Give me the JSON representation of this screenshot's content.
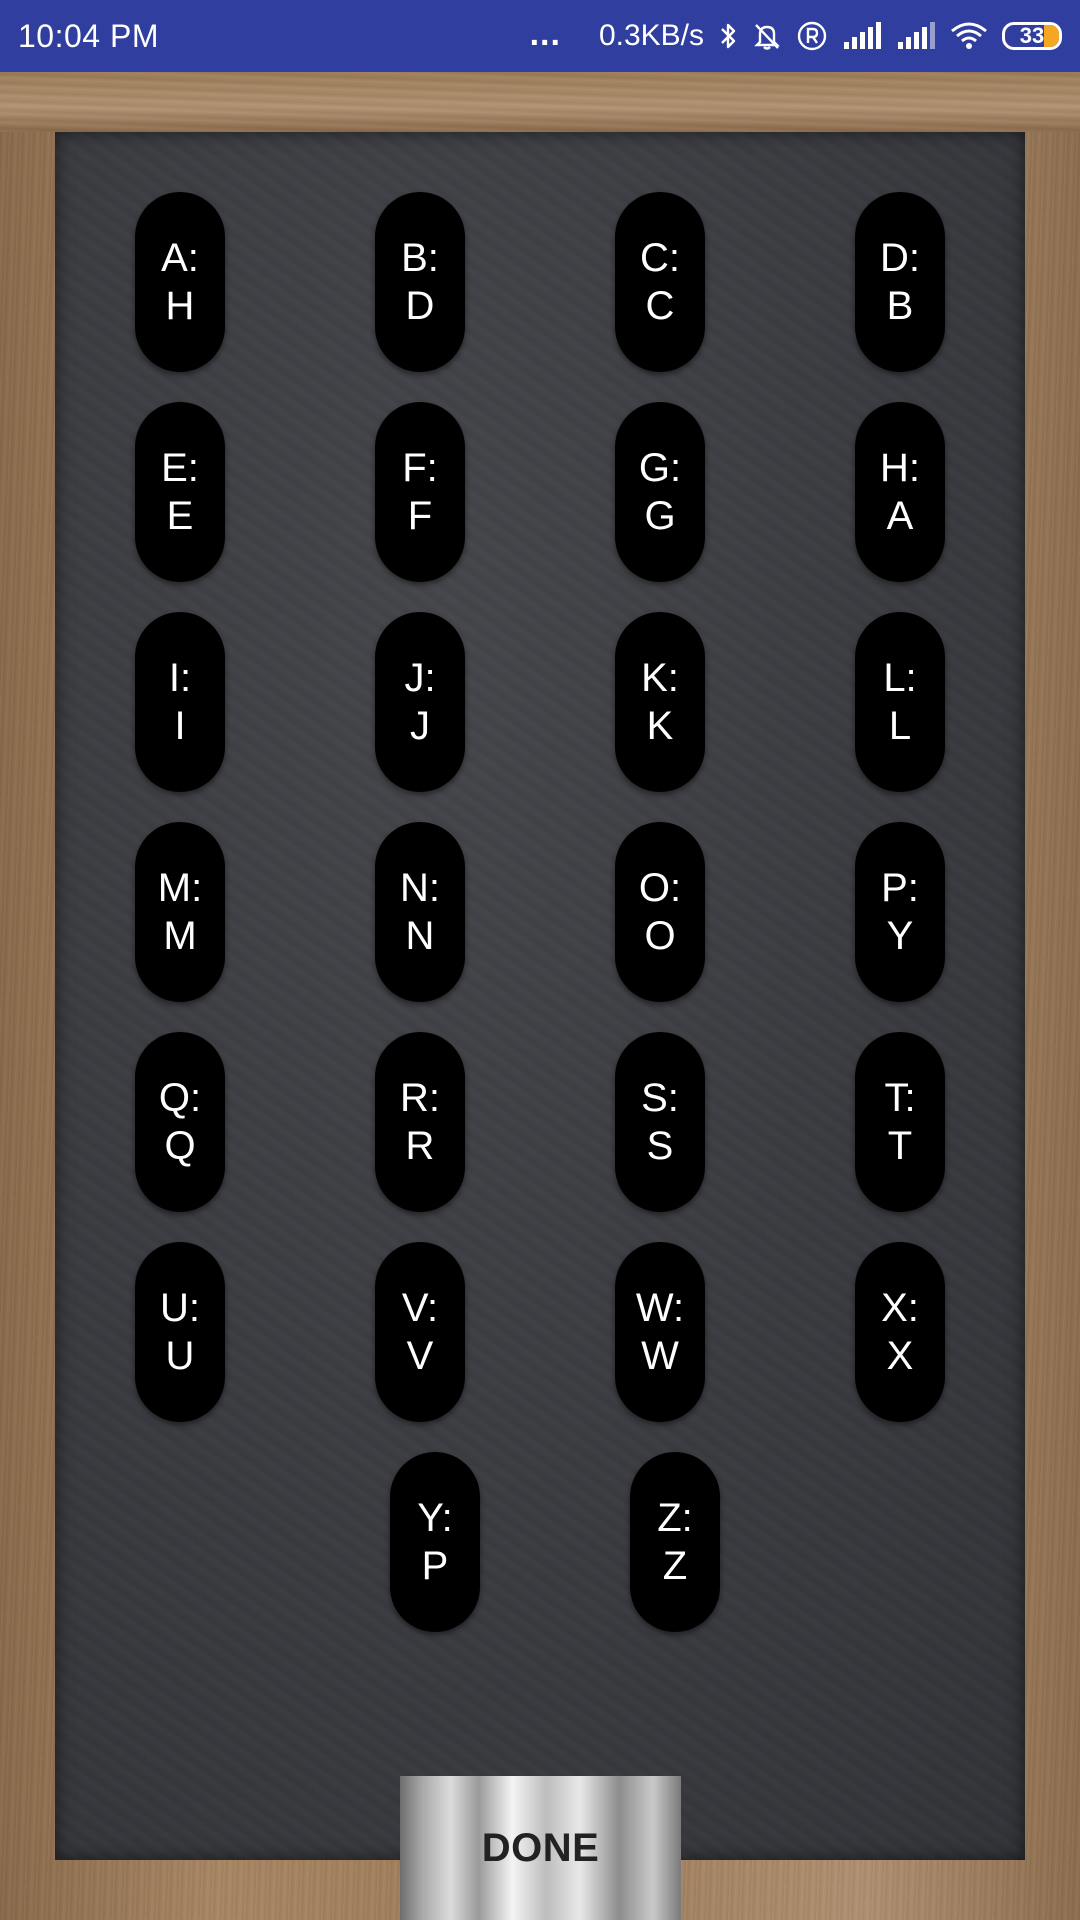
{
  "status_bar": {
    "time": "10:04 PM",
    "dots": "...",
    "speed": "0.3KB/s",
    "battery": "33",
    "icons": [
      "bluetooth-icon",
      "notifications-off-icon",
      "registered-icon",
      "signal-icon",
      "signal-icon",
      "wifi-icon",
      "battery-icon"
    ],
    "background_color": "#303f9f"
  },
  "mapping": [
    {
      "key": "A:",
      "value": "H"
    },
    {
      "key": "B:",
      "value": "D"
    },
    {
      "key": "C:",
      "value": "C"
    },
    {
      "key": "D:",
      "value": "B"
    },
    {
      "key": "E:",
      "value": "E"
    },
    {
      "key": "F:",
      "value": "F"
    },
    {
      "key": "G:",
      "value": "G"
    },
    {
      "key": "H:",
      "value": "A"
    },
    {
      "key": "I:",
      "value": "I"
    },
    {
      "key": "J:",
      "value": "J"
    },
    {
      "key": "K:",
      "value": "K"
    },
    {
      "key": "L:",
      "value": "L"
    },
    {
      "key": "M:",
      "value": "M"
    },
    {
      "key": "N:",
      "value": "N"
    },
    {
      "key": "O:",
      "value": "O"
    },
    {
      "key": "P:",
      "value": "Y"
    },
    {
      "key": "Q:",
      "value": "Q"
    },
    {
      "key": "R:",
      "value": "R"
    },
    {
      "key": "S:",
      "value": "S"
    },
    {
      "key": "T:",
      "value": "T"
    },
    {
      "key": "U:",
      "value": "U"
    },
    {
      "key": "V:",
      "value": "V"
    },
    {
      "key": "W:",
      "value": "W"
    },
    {
      "key": "X:",
      "value": "X"
    },
    {
      "key": "Y:",
      "value": "P"
    },
    {
      "key": "Z:",
      "value": "Z"
    }
  ],
  "done_button": {
    "label": "DONE"
  }
}
